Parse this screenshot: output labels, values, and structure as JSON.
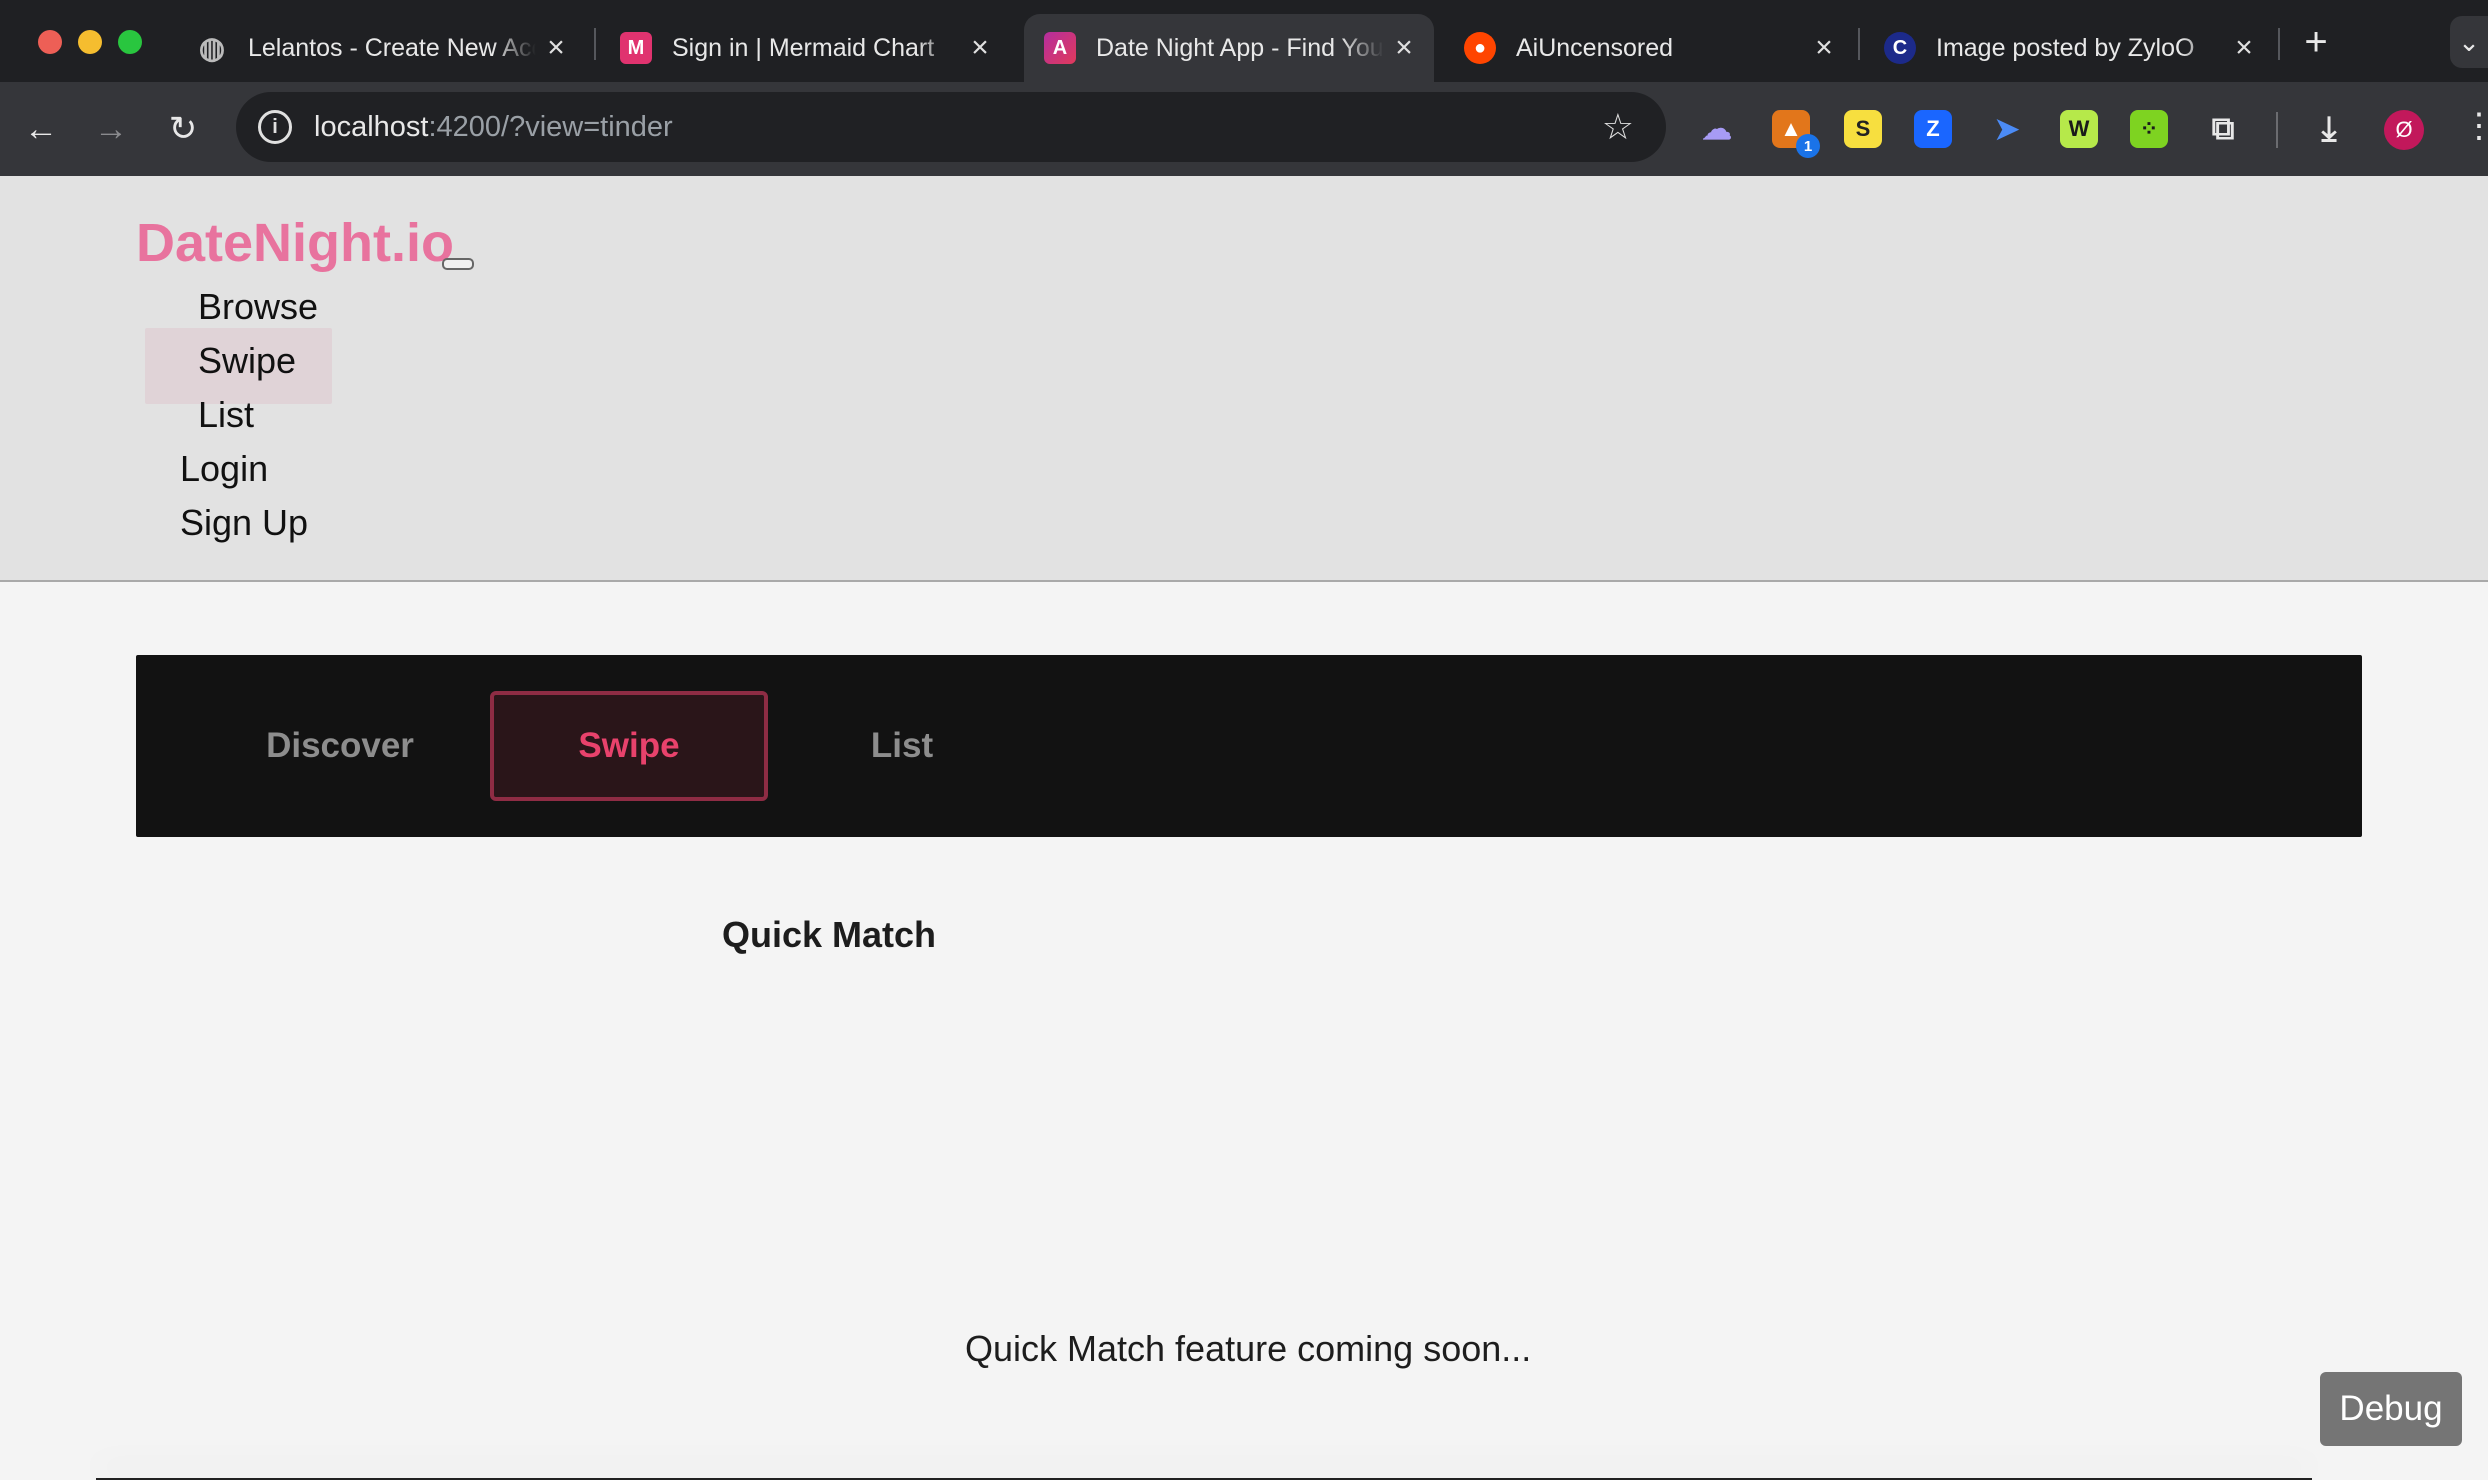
{
  "browser": {
    "tabs": [
      {
        "title": "Lelantos - Create New Account",
        "icon": "globe-icon"
      },
      {
        "title": "Sign in | Mermaid Chart",
        "icon": "mermaid-icon"
      },
      {
        "title": "Date Night App - Find Your Date",
        "icon": "angular-icon",
        "active": true
      },
      {
        "title": "AiUncensored",
        "icon": "reddit-icon"
      },
      {
        "title": "Image posted by ZyloO",
        "icon": "civitai-icon"
      }
    ],
    "address": {
      "host": "localhost",
      "rest": ":4200/?view=tinder"
    },
    "extensions": [
      "ghost-extension-icon",
      "metamask-extension-icon",
      "s-extension-icon",
      "z-extension-icon",
      "send-extension-icon",
      "w-extension-icon",
      "dice-extension-icon",
      "puzzle-icon"
    ],
    "extension_badge": "1",
    "profile_initial": "Ø"
  },
  "site": {
    "logo": "DateNight.io",
    "nav": [
      "Browse",
      "Swipe",
      "List"
    ],
    "auth": [
      "Login",
      "Sign Up"
    ]
  },
  "tabs": [
    "Discover",
    "Swipe",
    "List"
  ],
  "main": {
    "title": "Quick Match",
    "message": "Quick Match feature coming soon..."
  },
  "debug_label": "Debug",
  "colors": {
    "brand": "#e8739e",
    "active_tab": "#e8426c"
  }
}
